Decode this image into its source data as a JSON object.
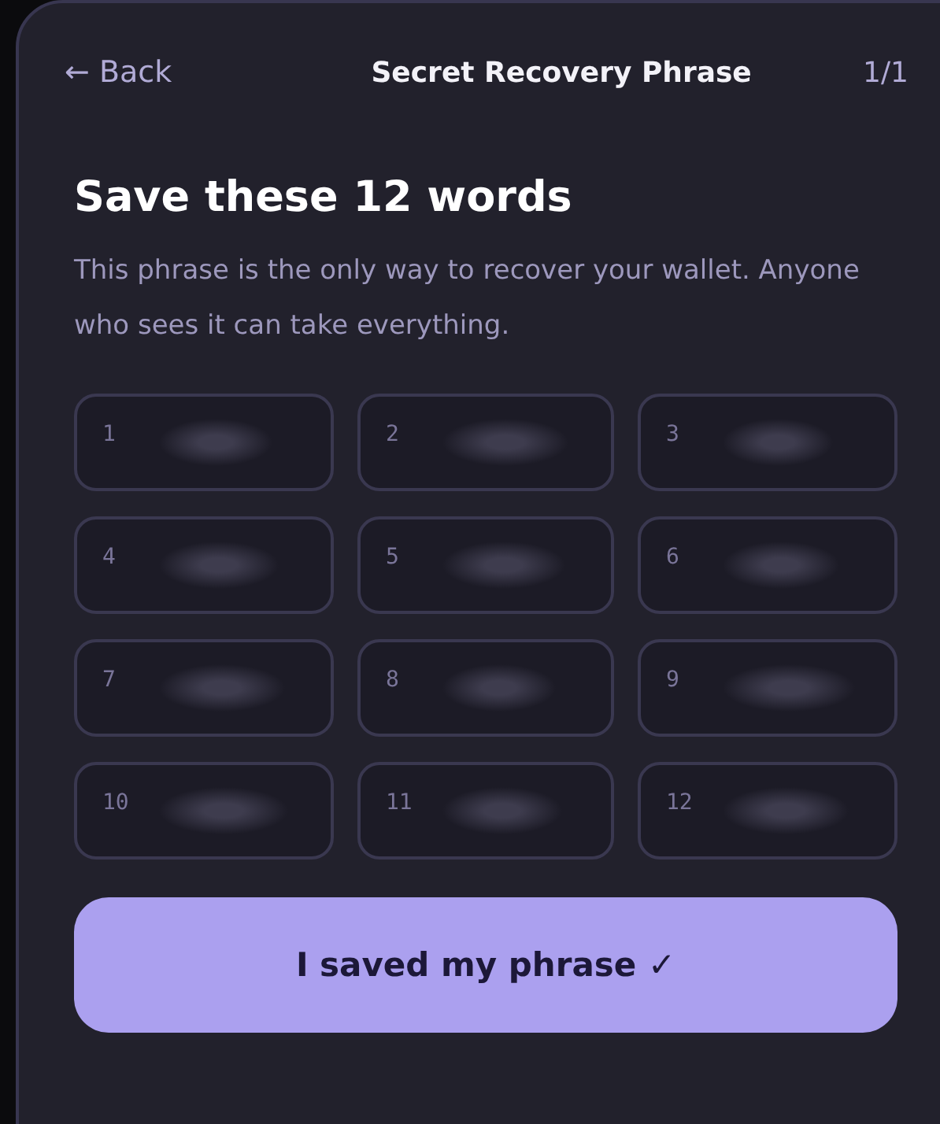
{
  "header": {
    "back": "← Back",
    "title": "Secret Recovery Phrase",
    "step": "1/1"
  },
  "heading": "Save these 12 words",
  "description": "This phrase is the only way to recover your wallet. Anyone who sees it can take everything.",
  "words": [
    {
      "number": "1"
    },
    {
      "number": "2"
    },
    {
      "number": "3"
    },
    {
      "number": "4"
    },
    {
      "number": "5"
    },
    {
      "number": "6"
    },
    {
      "number": "7"
    },
    {
      "number": "8"
    },
    {
      "number": "9"
    },
    {
      "number": "10"
    },
    {
      "number": "11"
    },
    {
      "number": "12"
    }
  ],
  "confirm_button": "I saved my phrase ✓"
}
